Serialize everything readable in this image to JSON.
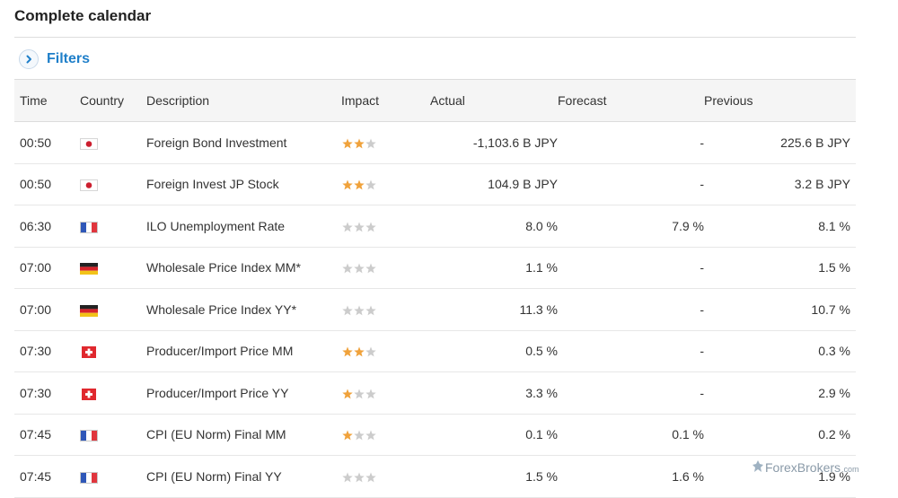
{
  "page": {
    "title": "Complete calendar"
  },
  "filters": {
    "label": "Filters"
  },
  "columns": {
    "time": "Time",
    "country": "Country",
    "description": "Description",
    "impact": "Impact",
    "actual": "Actual",
    "forecast": "Forecast",
    "previous": "Previous"
  },
  "colors": {
    "accent": "#1f7fc9",
    "star_on": "#f0a23b",
    "star_off": "#cccccc"
  },
  "rows": [
    {
      "time": "00:50",
      "country": "japan-flag",
      "description": "Foreign Bond Investment",
      "impact": 2,
      "actual": "-1,103.6 B JPY",
      "forecast": "-",
      "previous": "225.6 B JPY"
    },
    {
      "time": "00:50",
      "country": "japan-flag",
      "description": "Foreign Invest JP Stock",
      "impact": 2,
      "actual": "104.9 B JPY",
      "forecast": "-",
      "previous": "3.2 B JPY"
    },
    {
      "time": "06:30",
      "country": "france-flag",
      "description": "ILO Unemployment Rate",
      "impact": 0,
      "actual": "8.0 %",
      "forecast": "7.9 %",
      "previous": "8.1 %"
    },
    {
      "time": "07:00",
      "country": "germany-flag",
      "description": "Wholesale Price Index MM*",
      "impact": 0,
      "actual": "1.1 %",
      "forecast": "-",
      "previous": "1.5 %"
    },
    {
      "time": "07:00",
      "country": "germany-flag",
      "description": "Wholesale Price Index YY*",
      "impact": 0,
      "actual": "11.3 %",
      "forecast": "-",
      "previous": "10.7 %"
    },
    {
      "time": "07:30",
      "country": "switzerland-flag",
      "description": "Producer/Import Price MM",
      "impact": 2,
      "actual": "0.5 %",
      "forecast": "-",
      "previous": "0.3 %"
    },
    {
      "time": "07:30",
      "country": "switzerland-flag",
      "description": "Producer/Import Price YY",
      "impact": 1,
      "actual": "3.3 %",
      "forecast": "-",
      "previous": "2.9 %"
    },
    {
      "time": "07:45",
      "country": "france-flag",
      "description": "CPI (EU Norm) Final MM",
      "impact": 1,
      "actual": "0.1 %",
      "forecast": "0.1 %",
      "previous": "0.2 %"
    },
    {
      "time": "07:45",
      "country": "france-flag",
      "description": "CPI (EU Norm) Final YY",
      "impact": 0,
      "actual": "1.5 %",
      "forecast": "1.6 %",
      "previous": "1.9 %"
    }
  ],
  "watermark": {
    "text": "ForexBrokers",
    "suffix": ".com"
  }
}
